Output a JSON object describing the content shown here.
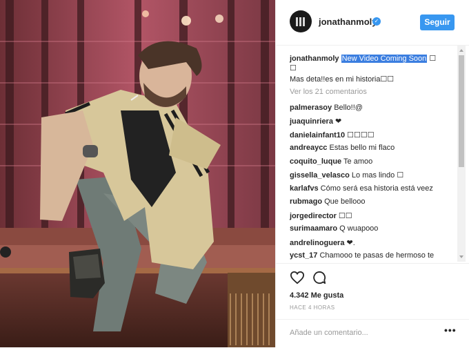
{
  "post": {
    "username": "jonathanmoly",
    "follow_label": "Seguir",
    "caption_part1": "New Video Coming Soon",
    "caption_tail": " ☐",
    "caption_line2": "☐",
    "caption_line3": "Mas deta!!es en mi historia☐☐",
    "view_comments": "Ver los 21 comentarios",
    "likes": "4.342 Me gusta",
    "time": "HACE 4 HORAS",
    "add_comment_placeholder": "Añade un comentario...",
    "more_dots": "•••"
  },
  "comments": [
    {
      "user": "palmerasoy",
      "text": "Bello!!@"
    },
    {
      "user": "juaquinriera",
      "text": "❤"
    },
    {
      "user": "danielainfant10",
      "text": "☐☐☐☐"
    },
    {
      "user": "andreaycc",
      "text": "Estas bello mi flaco"
    },
    {
      "user": "coquito_luque",
      "text": "Te amoo"
    },
    {
      "user": "gissella_velasco",
      "text": "Lo mas lindo ☐"
    },
    {
      "user": "karlafvs",
      "text": "Cómo será esa historia está veez"
    },
    {
      "user": "rubmago",
      "text": "Que bellooo"
    },
    {
      "user": "jorgedirector",
      "text": "☐☐"
    },
    {
      "user": "surimaamaro",
      "text": "Q wuapooo"
    },
    {
      "user": "andrelinoguera",
      "text": "❤."
    },
    {
      "user": "ycst_17",
      "text": "Chamooo te pasas de hermoso te"
    }
  ],
  "colors": {
    "accent": "#3897f0",
    "highlight": "#3b7ee0"
  },
  "icons": [
    "verified-badge-icon",
    "heart-icon",
    "comment-icon",
    "more-options-icon"
  ]
}
